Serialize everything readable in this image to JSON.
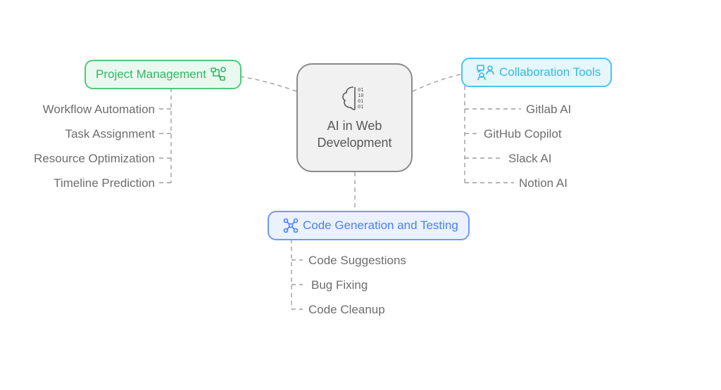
{
  "center": {
    "label": "AI in Web Development"
  },
  "branches": {
    "project_management": {
      "label": "Project Management",
      "icon": "flow-icon",
      "items": [
        "Workflow Automation",
        "Task Assignment",
        "Resource Optimization",
        "Timeline Prediction"
      ]
    },
    "collaboration_tools": {
      "label": "Collaboration Tools",
      "icon": "people-chat-icon",
      "items": [
        "Gitlab AI",
        "GitHub Copilot",
        "Slack AI",
        "Notion AI"
      ]
    },
    "code_generation": {
      "label": "Code Generation and Testing",
      "icon": "nodes-icon",
      "items": [
        "Code Suggestions",
        "Bug Fixing",
        "Code Cleanup"
      ]
    }
  },
  "colors": {
    "green": "#34b566",
    "cyan": "#33b8e6",
    "blue": "#4a7fff",
    "gray": "#6d6d6d"
  }
}
